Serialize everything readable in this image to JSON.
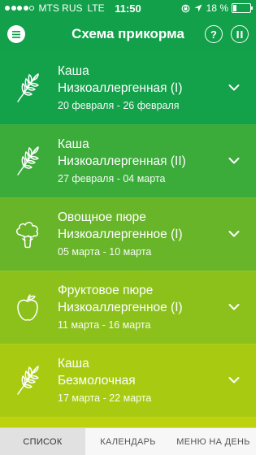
{
  "status_bar": {
    "carrier": "MTS RUS",
    "network": "LTE",
    "time": "11:50",
    "battery_text": "18 %",
    "battery_level": 0.18
  },
  "header": {
    "title": "Схема прикорма",
    "help_label": "?"
  },
  "stages": [
    {
      "icon": "wheat-icon",
      "category": "Каша",
      "name": "Низкоаллергенная (I)",
      "dates": "20 февраля - 26 февраля",
      "color": "#13a14a"
    },
    {
      "icon": "wheat-icon",
      "category": "Каша",
      "name": "Низкоаллергенная (II)",
      "dates": "27 февраля - 04 марта",
      "color": "#3bab3a"
    },
    {
      "icon": "broccoli-icon",
      "category": "Овощное пюре",
      "name": "Низкоаллергенное (I)",
      "dates": "05 марта - 10 марта",
      "color": "#68b52a"
    },
    {
      "icon": "apple-icon",
      "category": "Фруктовое пюре",
      "name": "Низкоаллергенное (I)",
      "dates": "11 марта - 16 марта",
      "color": "#8cc11c"
    },
    {
      "icon": "wheat-icon",
      "category": "Каша",
      "name": "Безмолочная",
      "dates": "17 марта - 22 марта",
      "color": "#a8cb12"
    }
  ],
  "partial_row_color": "#bcd20d",
  "tabs": [
    {
      "label": "СПИСОК",
      "active": true
    },
    {
      "label": "КАЛЕНДАРЬ",
      "active": false
    },
    {
      "label": "МЕНЮ НА ДЕНЬ",
      "active": false
    }
  ]
}
